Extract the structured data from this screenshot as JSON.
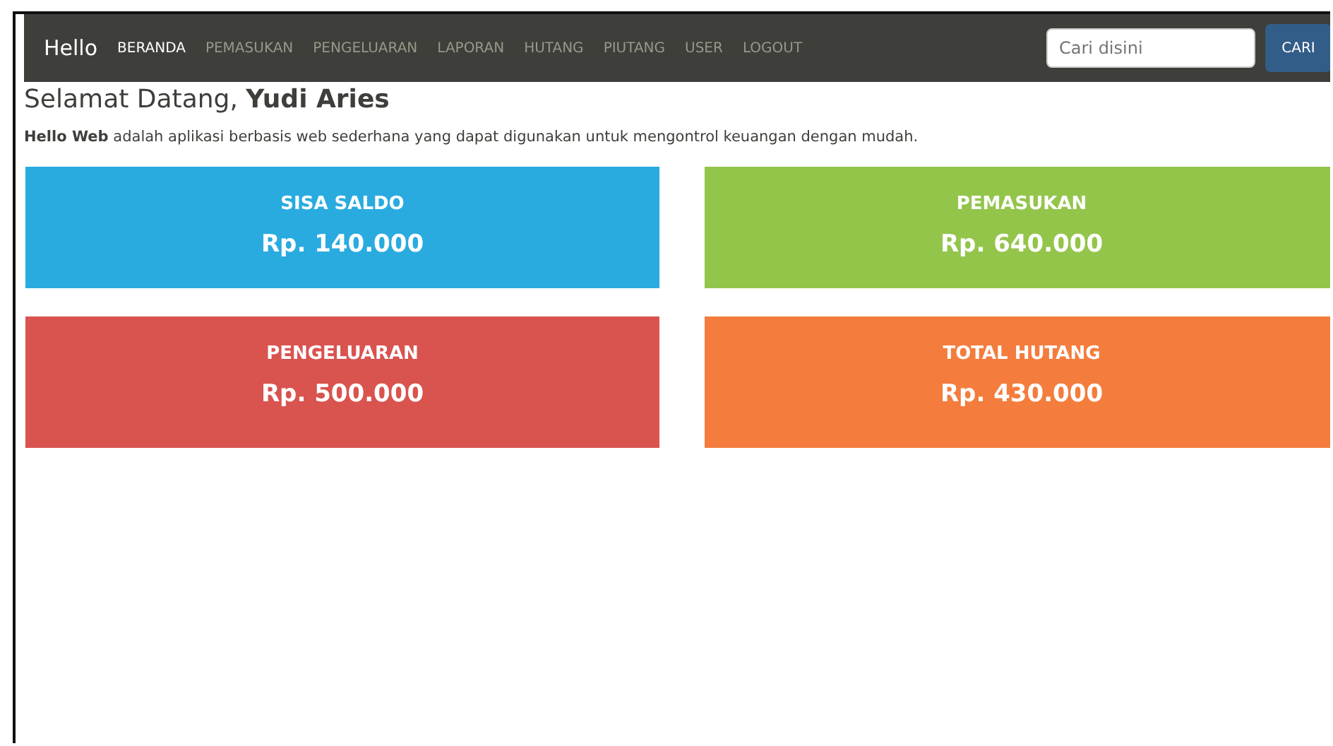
{
  "navbar": {
    "brand": "Hello",
    "items": [
      {
        "label": "BERANDA",
        "selected": true
      },
      {
        "label": "PEMASUKAN",
        "selected": false
      },
      {
        "label": "PENGELUARAN",
        "selected": false
      },
      {
        "label": "LAPORAN",
        "selected": false
      },
      {
        "label": "HUTANG",
        "selected": false
      },
      {
        "label": "PIUTANG",
        "selected": false
      },
      {
        "label": "USER",
        "selected": false
      },
      {
        "label": "LOGOUT",
        "selected": false
      }
    ],
    "search": {
      "placeholder": "Cari disini"
    },
    "search_button": "CARI"
  },
  "greeting": "Selamat Datang, **Yudi Aries**",
  "intro": "**Hello Web** adalah aplikasi berbasis web sederhana yang dapat digunakan untuk mengontrol keuangan dengan mudah.",
  "cards": [
    {
      "title": "SISA SALDO",
      "value": "Rp. 140.000",
      "color": "#29abe0"
    },
    {
      "title": "PEMASUKAN",
      "value": "Rp. 640.000",
      "color": "#93c54b"
    },
    {
      "title": "PENGELUARAN",
      "value": "Rp. 500.000",
      "color": "#d9534f"
    },
    {
      "title": "TOTAL HUTANG",
      "value": "Rp. 430.000",
      "color": "#f47c3c"
    }
  ]
}
